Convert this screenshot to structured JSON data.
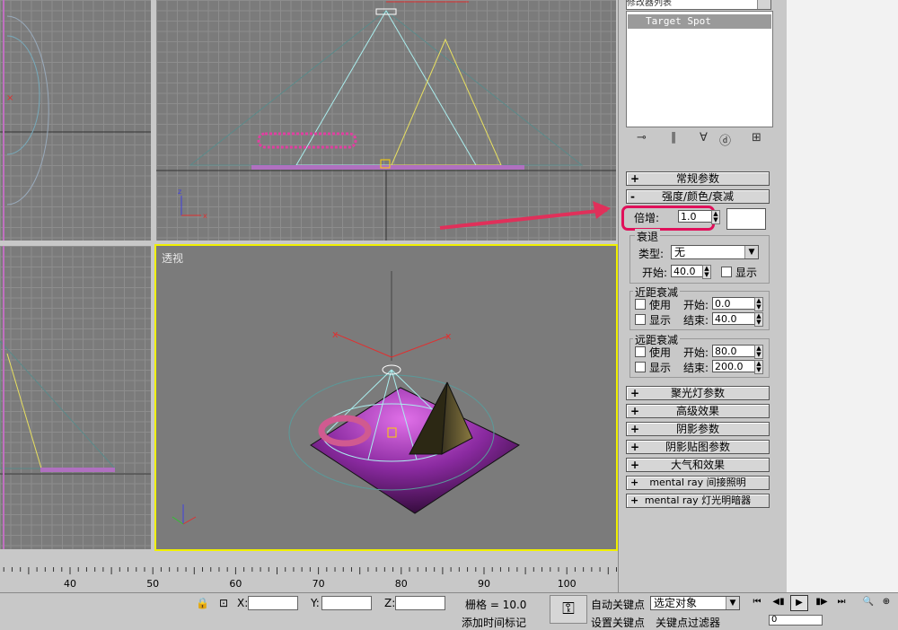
{
  "viewports": {
    "perspective_label": "透视"
  },
  "modifier_panel": {
    "list_label": "修改器列表",
    "stack_item": "Target Spot"
  },
  "rollouts": {
    "general": {
      "sign": "+",
      "label": "常规参数"
    },
    "intensity": {
      "sign": "-",
      "label": "强度/颜色/衰减"
    },
    "spotlight": {
      "sign": "+",
      "label": "聚光灯参数"
    },
    "advanced": {
      "sign": "+",
      "label": "高级效果"
    },
    "shadow": {
      "sign": "+",
      "label": "阴影参数"
    },
    "shadow_map": {
      "sign": "+",
      "label": "阴影贴图参数"
    },
    "atmosphere": {
      "sign": "+",
      "label": "大气和效果"
    },
    "mr_indirect": {
      "sign": "+",
      "label": "mental ray 间接照明"
    },
    "mr_shader": {
      "sign": "+",
      "label": "mental ray 灯光明暗器"
    }
  },
  "intensity": {
    "multiplier_label": "倍增:",
    "multiplier_value": "1.0",
    "decay_group": "衰退",
    "type_label": "类型:",
    "type_value": "无",
    "start_label": "开始:",
    "start_value": "40.0",
    "show_label": "显示",
    "near_group": "近距衰减",
    "near_use": "使用",
    "near_show": "显示",
    "near_start_label": "开始:",
    "near_start_value": "0.0",
    "near_end_label": "结束:",
    "near_end_value": "40.0",
    "far_group": "远距衰减",
    "far_use": "使用",
    "far_show": "显示",
    "far_start_label": "开始:",
    "far_start_value": "80.0",
    "far_end_label": "结束:",
    "far_end_value": "200.0"
  },
  "timeline": {
    "ticks": [
      "40",
      "50",
      "60",
      "70",
      "80",
      "90",
      "100"
    ]
  },
  "status": {
    "x_label": "X:",
    "y_label": "Y:",
    "z_label": "Z:",
    "grid_text": "栅格 = 10.0",
    "add_time_tag": "添加时间标记",
    "auto_key": "自动关键点",
    "set_key": "设置关键点",
    "selected_object": "选定对象",
    "key_filters": "关键点过滤器",
    "frame_value": "0"
  },
  "colors": {
    "viewport_bg": "#7b7b7b",
    "active_border": "#f0f000",
    "highlight": "#e0105a",
    "arrow": "#e0305a"
  }
}
